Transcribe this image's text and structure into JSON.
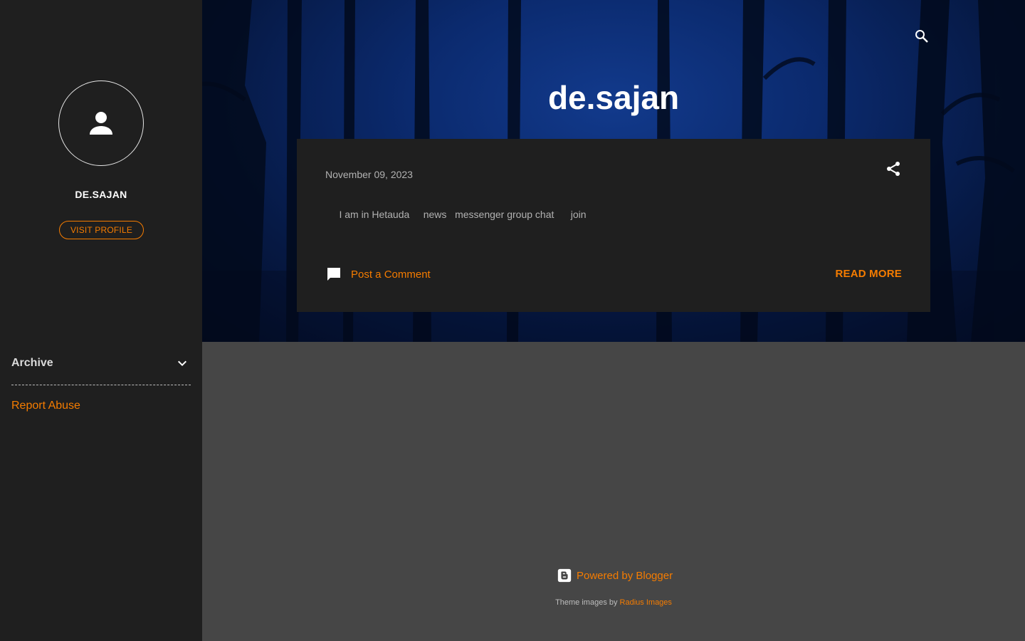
{
  "sidebar": {
    "profile_name": "DE.SAJAN",
    "visit_profile_label": "VISIT PROFILE",
    "archive_label": "Archive",
    "report_abuse_label": "Report Abuse"
  },
  "header": {
    "blog_title": "de.sajan"
  },
  "post": {
    "date": "November 09, 2023",
    "snippet": " ‌‌‌‌‌‌‌‌‌‌ ‌‌‌‌‌‌‌ ‌ ‌‌‌‌‌‌ ‌‌ I am in Hetauda ‌‌ ‌‌‌‌‌ ‌‌‌‌‌‌‌‌ ‌‌‌‌‌‌‌‌ news ‌‌‌‌‌ ‌‌‌‌‌‌‌‌‌‌‌ messenger group chat ‌‌‌‌‌‌ ‌‌ ‌ ‌‌ ‌‌‌‌‌‌‌ join ‌‌‌‌‌ ‌‌‌‌ ‌",
    "comment_label": "Post a Comment",
    "read_more_label": "READ MORE"
  },
  "footer": {
    "powered_label": "Powered by Blogger",
    "theme_prefix": "Theme images by ",
    "theme_link": "Radius Images"
  },
  "colors": {
    "accent": "#f57c00",
    "sidebar_bg": "#1f1f1f",
    "page_bg": "#464646",
    "card_bg": "#1f1f1f"
  },
  "icons": {
    "avatar": "person-icon",
    "archive": "chevron-down-icon",
    "search": "search-icon",
    "share": "share-icon",
    "comment": "comment-icon",
    "blogger": "blogger-icon"
  }
}
